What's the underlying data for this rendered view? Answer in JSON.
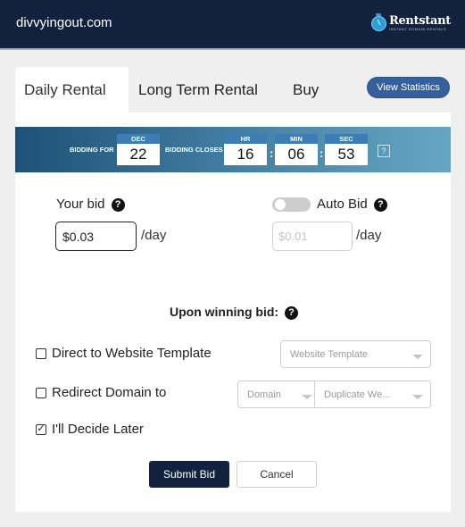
{
  "header": {
    "domain": "divvyingout.com",
    "logo": {
      "name": "Rentstant",
      "tagline": "INSTANT DOMAIN RENTALS",
      "icon": "stopwatch-icon"
    }
  },
  "tabs": [
    {
      "label": "Daily Rental",
      "active": true
    },
    {
      "label": "Long Term Rental",
      "active": false
    },
    {
      "label": "Buy",
      "active": false
    }
  ],
  "view_statistics_label": "View Statistics",
  "banner": {
    "bidding_for_label": "BIDDING FOR",
    "date": {
      "month": "DEC",
      "day": "22"
    },
    "bidding_closes_label": "BIDDING CLOSES",
    "countdown": {
      "hr_label": "HR",
      "hr": "16",
      "min_label": "MIN",
      "min": "06",
      "sec_label": "SEC",
      "sec": "53"
    },
    "colon": ":",
    "help_label": "?"
  },
  "bid": {
    "your_bid_label": "Your bid",
    "your_bid_value": "$0.03",
    "per_day": "/day",
    "auto_bid_label": "Auto Bid",
    "auto_bid_enabled": false,
    "auto_bid_placeholder": "$0.01",
    "help_glyph": "?"
  },
  "winning": {
    "label": "Upon winning bid:",
    "options": [
      {
        "label": "Direct to Website Template",
        "checked": false,
        "mark": ""
      },
      {
        "label": "Redirect Domain to",
        "checked": false,
        "mark": ""
      },
      {
        "label": "I'll Decide Later",
        "checked": true,
        "mark": "✓"
      }
    ],
    "website_template_select": "Website Template",
    "domain_select": "Domain",
    "duplicate_select": "Duplicate We..."
  },
  "actions": {
    "submit_label": "Submit Bid",
    "cancel_label": "Cancel"
  }
}
